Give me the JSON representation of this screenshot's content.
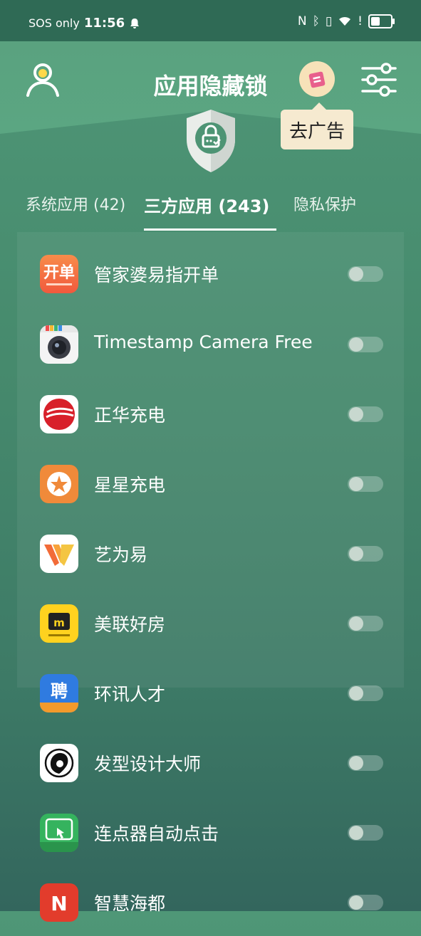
{
  "status_bar": {
    "carrier": "SOS only",
    "time": "11:56"
  },
  "header": {
    "title": "应用隐藏锁",
    "ad_tooltip": "去广告",
    "icons": [
      "person-icon",
      "ad-gift-icon",
      "settings-sliders-icon",
      "shield-lock-icon"
    ]
  },
  "tabs": [
    {
      "label": "系统应用 (42)",
      "active": false
    },
    {
      "label": "三方应用 (243)",
      "active": true
    },
    {
      "label": "隐私保护",
      "active": false
    }
  ],
  "apps": [
    {
      "name": "管家婆易指开单",
      "enabled": false
    },
    {
      "name": "Timestamp Camera Free",
      "enabled": false
    },
    {
      "name": "正华充电",
      "enabled": false
    },
    {
      "name": "星星充电",
      "enabled": false
    },
    {
      "name": "艺为易",
      "enabled": false
    },
    {
      "name": "美联好房",
      "enabled": false
    },
    {
      "name": "环讯人才",
      "enabled": false
    },
    {
      "name": "发型设计大师",
      "enabled": false
    },
    {
      "name": "连点器自动点击",
      "enabled": false
    },
    {
      "name": "智慧海都",
      "enabled": false
    }
  ],
  "colors": {
    "background": "#468a6d",
    "status_bar": "#2f6a55",
    "tooltip": "#f6ead0"
  }
}
